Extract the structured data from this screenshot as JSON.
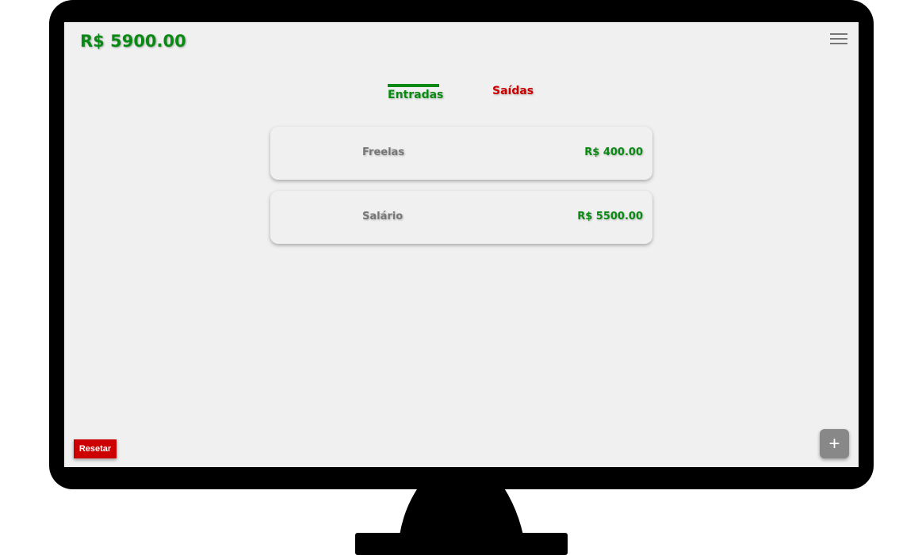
{
  "header": {
    "balance": "R$ 5900.00",
    "menu_icon": "hamburger-icon"
  },
  "tabs": [
    {
      "label": "Entradas",
      "active": true
    },
    {
      "label": "Saídas",
      "active": false
    }
  ],
  "entries": [
    {
      "name": "Freelas",
      "value": "R$ 400.00"
    },
    {
      "name": "Salário",
      "value": "R$ 5500.00"
    }
  ],
  "footer": {
    "reset_label": "Resetar",
    "add_label": "+"
  },
  "colors": {
    "income": "#0a8a14",
    "expense": "#cc0000",
    "background": "#f0f0f0"
  }
}
